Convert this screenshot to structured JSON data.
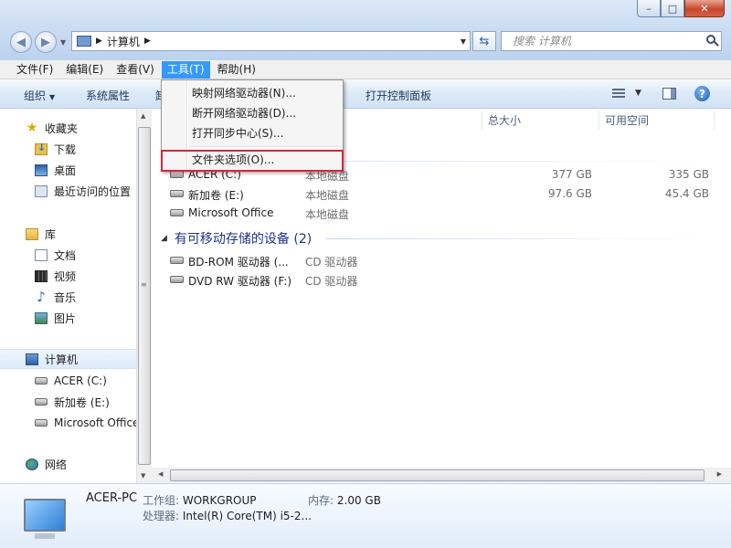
{
  "window": {
    "controls": {
      "minimize": "–",
      "maximize": "□",
      "close": "✕"
    }
  },
  "navigation": {
    "breadcrumb": "计算机",
    "search_placeholder": "搜索 计算机"
  },
  "menubar": [
    {
      "label": "文件(F)"
    },
    {
      "label": "编辑(E)"
    },
    {
      "label": "查看(V)"
    },
    {
      "label": "工具(T)",
      "active": true
    },
    {
      "label": "帮助(H)"
    }
  ],
  "toolbar": {
    "organize": "组织",
    "system_properties": "系统属性",
    "partial": "卸",
    "open_control_panel": "打开控制面板"
  },
  "tools_menu": {
    "items": [
      {
        "label": "映射网络驱动器(N)..."
      },
      {
        "label": "断开网络驱动器(D)..."
      },
      {
        "label": "打开同步中心(S)..."
      },
      {
        "label": "文件夹选项(O)..."
      }
    ],
    "highlighted": "文件夹选项(O)..."
  },
  "sidebar": {
    "favorites": {
      "label": "收藏夹",
      "items": [
        "下载",
        "桌面",
        "最近访问的位置"
      ]
    },
    "libraries": {
      "label": "库",
      "items": [
        "文档",
        "视频",
        "音乐",
        "图片"
      ]
    },
    "computer": {
      "label": "计算机",
      "items": [
        "ACER (C:)",
        "新加卷 (E:)",
        "Microsoft Office"
      ]
    },
    "network": {
      "label": "网络"
    }
  },
  "columns": {
    "total": "总大小",
    "free": "可用空间"
  },
  "groups": {
    "hard_disks": {
      "rows": [
        {
          "name": "ACER (C:)",
          "type": "本地磁盘",
          "total": "377 GB",
          "free": "335 GB"
        },
        {
          "name": "新加卷 (E:)",
          "type": "本地磁盘",
          "total": "97.6 GB",
          "free": "45.4 GB"
        },
        {
          "name": "Microsoft Office",
          "type": "本地磁盘",
          "total": "",
          "free": ""
        }
      ]
    },
    "removable": {
      "label": "有可移动存储的设备 (2)",
      "rows": [
        {
          "name": "BD-ROM 驱动器 (...",
          "type": "CD 驱动器"
        },
        {
          "name": "DVD RW 驱动器 (F:)",
          "type": "CD 驱动器"
        }
      ]
    }
  },
  "details": {
    "computer_name": "ACER-PC",
    "workgroup_label": "工作组:",
    "workgroup": "WORKGROUP",
    "memory_label": "内存:",
    "memory": "2.00 GB",
    "processor_label": "处理器:",
    "processor": "Intel(R) Core(TM) i5-2..."
  }
}
